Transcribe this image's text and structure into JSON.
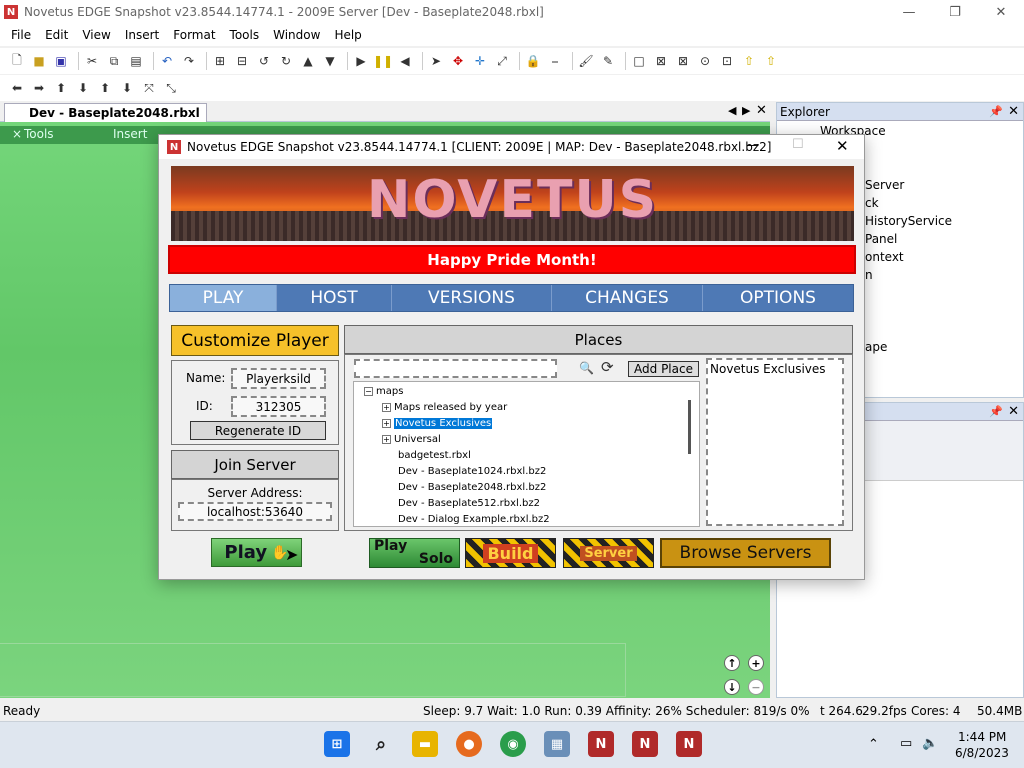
{
  "studio": {
    "title": "Novetus EDGE Snapshot v23.8544.14774.1 - 2009E Server [Dev - Baseplate2048.rbxl]",
    "menu": [
      "File",
      "Edit",
      "View",
      "Insert",
      "Format",
      "Tools",
      "Window",
      "Help"
    ],
    "doc_tab": "Dev - Baseplate2048.rbxl",
    "strip_tools": "Tools",
    "strip_insert": "Insert",
    "explorer": {
      "title": "Explorer",
      "items": [
        "Workspace",
        "Server",
        "ck",
        "HistoryService",
        "Panel",
        "ontext",
        "n",
        "ape"
      ]
    },
    "status": {
      "ready": "Ready",
      "perf": "Sleep: 9.7 Wait: 1.0 Run: 0.39 Affinity: 26% Scheduler: 819/s 0%",
      "t": "t 264.6",
      "fps": "29.2fps",
      "cores": "Cores: 4",
      "mem": "50.4MB"
    }
  },
  "dialog": {
    "title": "Novetus EDGE Snapshot v23.8544.14774.1 [CLIENT: 2009E | MAP: Dev - Baseplate2048.rbxl.bz2]",
    "banner_text": "NOVETUS",
    "announcement": "Happy Pride Month!",
    "tabs": [
      "PLAY",
      "HOST",
      "VERSIONS",
      "CHANGES",
      "OPTIONS"
    ],
    "active_tab": "PLAY",
    "customize_label": "Customize Player",
    "name_label": "Name:",
    "name_value": "Playerksild",
    "id_label": "ID:",
    "id_value": "312305",
    "regen_label": "Regenerate ID",
    "join_header": "Join Server",
    "server_address_label": "Server Address:",
    "server_address_value": "localhost:53640",
    "play_label": "Play",
    "places_header": "Places",
    "add_place_label": "Add Place",
    "exclusives_label": "Novetus Exclusives",
    "tree": {
      "root": "maps",
      "folders": [
        "Maps released by year",
        "Novetus Exclusives",
        "Universal"
      ],
      "files": [
        "badgetest.rbxl",
        "Dev - Baseplate1024.rbxl.bz2",
        "Dev - Baseplate2048.rbxl.bz2",
        "Dev - Baseplate512.rbxl.bz2",
        "Dev - Dialog Example.rbxl.bz2"
      ]
    },
    "play_solo_top": "Play",
    "play_solo_bottom": "Solo",
    "build_label": "Build",
    "server_label": "Server",
    "browse_label": "Browse Servers"
  },
  "taskbar": {
    "time": "1:44 PM",
    "date": "6/8/2023"
  }
}
